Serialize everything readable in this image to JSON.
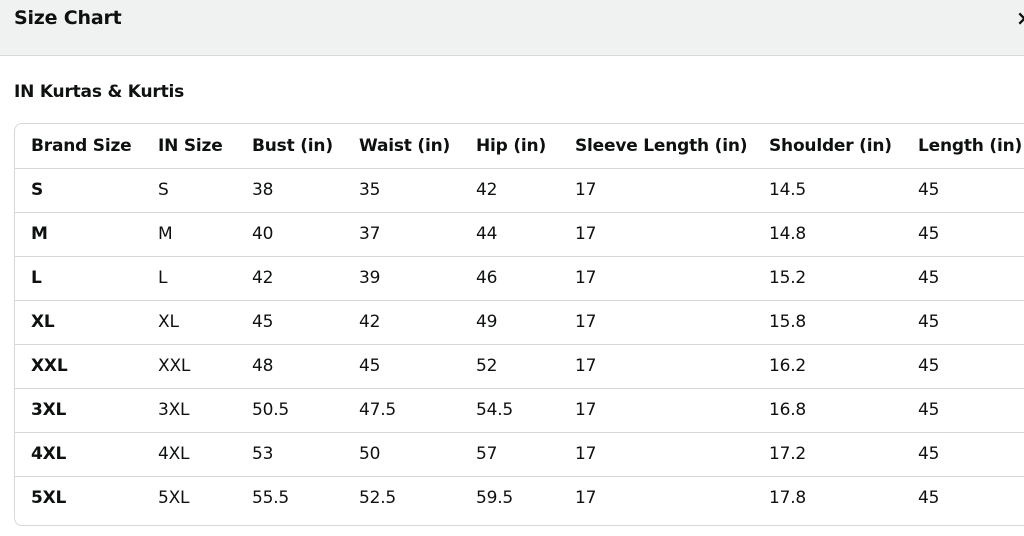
{
  "dialog": {
    "title": "Size Chart",
    "close_label": "×"
  },
  "section": {
    "title": "IN Kurtas & Kurtis"
  },
  "table": {
    "headers": [
      "Brand Size",
      "IN Size",
      "Bust (in)",
      "Waist (in)",
      "Hip (in)",
      "Sleeve Length (in)",
      "Shoulder (in)",
      "Length (in)"
    ],
    "rows": [
      [
        "S",
        "S",
        "38",
        "35",
        "42",
        "17",
        "14.5",
        "45"
      ],
      [
        "M",
        "M",
        "40",
        "37",
        "44",
        "17",
        "14.8",
        "45"
      ],
      [
        "L",
        "L",
        "42",
        "39",
        "46",
        "17",
        "15.2",
        "45"
      ],
      [
        "XL",
        "XL",
        "45",
        "42",
        "49",
        "17",
        "15.8",
        "45"
      ],
      [
        "XXL",
        "XXL",
        "48",
        "45",
        "52",
        "17",
        "16.2",
        "45"
      ],
      [
        "3XL",
        "3XL",
        "50.5",
        "47.5",
        "54.5",
        "17",
        "16.8",
        "45"
      ],
      [
        "4XL",
        "4XL",
        "53",
        "50",
        "57",
        "17",
        "17.2",
        "45"
      ],
      [
        "5XL",
        "5XL",
        "55.5",
        "52.5",
        "59.5",
        "17",
        "17.8",
        "45"
      ]
    ]
  }
}
